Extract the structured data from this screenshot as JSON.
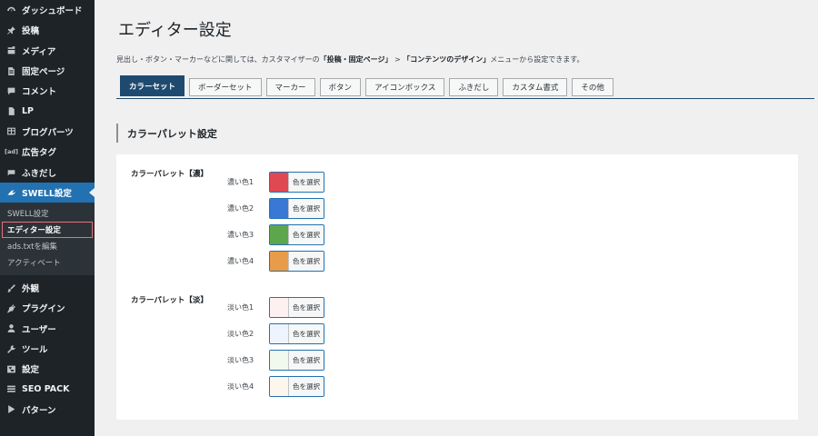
{
  "sidebar": {
    "items": [
      {
        "label": "ダッシュボード",
        "icon": "dashboard-icon"
      },
      {
        "label": "投稿",
        "icon": "pin-icon"
      },
      {
        "label": "メディア",
        "icon": "media-icon"
      },
      {
        "label": "固定ページ",
        "icon": "page-icon"
      },
      {
        "label": "コメント",
        "icon": "comment-icon"
      },
      {
        "label": "LP",
        "icon": "document-icon"
      },
      {
        "label": "ブログパーツ",
        "icon": "grid-icon"
      },
      {
        "label": "広告タグ",
        "icon": "ad-icon",
        "icon_text": "[ad]"
      },
      {
        "label": "ふきだし",
        "icon": "balloon-icon"
      },
      {
        "label": "SWELL設定",
        "icon": "swell-icon"
      }
    ],
    "submenu": [
      "SWELL設定",
      "エディター設定",
      "ads.txtを編集",
      "アクティベート"
    ],
    "items_after": [
      {
        "label": "外観",
        "icon": "brush-icon"
      },
      {
        "label": "プラグイン",
        "icon": "plugin-icon"
      },
      {
        "label": "ユーザー",
        "icon": "user-icon"
      },
      {
        "label": "ツール",
        "icon": "wrench-icon"
      },
      {
        "label": "設定",
        "icon": "settings-icon"
      },
      {
        "label": "SEO PACK",
        "icon": "list-icon"
      },
      {
        "label": "パターン",
        "icon": "pattern-icon"
      }
    ]
  },
  "main": {
    "title": "エディター設定",
    "description": {
      "before": "見出し・ボタン・マーカーなどに関しては、カスタマイザーの",
      "link1": "「投稿・固定ページ」",
      "sep": " > ",
      "link2": "「コンテンツのデザイン」",
      "after": "メニューから設定できます。"
    },
    "tabs": [
      "カラーセット",
      "ボーダーセット",
      "マーカー",
      "ボタン",
      "アイコンボックス",
      "ふきだし",
      "カスタム書式",
      "その他"
    ],
    "section_title": "カラーパレット設定",
    "picker_label": "色を選択",
    "groups": [
      {
        "label": "カラーパレット【濃】",
        "rows": [
          {
            "label": "濃い色1",
            "color": "#e04852"
          },
          {
            "label": "濃い色2",
            "color": "#3a78d6"
          },
          {
            "label": "濃い色3",
            "color": "#5ea64b"
          },
          {
            "label": "濃い色4",
            "color": "#e89b48"
          }
        ]
      },
      {
        "label": "カラーパレット【淡】",
        "rows": [
          {
            "label": "淡い色1",
            "color": "#fdf0f1"
          },
          {
            "label": "淡い色2",
            "color": "#eef4fd"
          },
          {
            "label": "淡い色3",
            "color": "#f1f8ee"
          },
          {
            "label": "淡い色4",
            "color": "#fdf6ec"
          }
        ]
      }
    ]
  }
}
